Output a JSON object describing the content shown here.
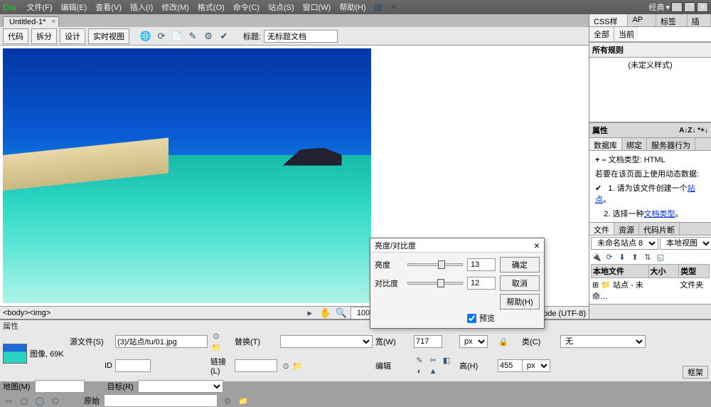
{
  "menubar": {
    "logo": "Dw",
    "items": [
      "文件(F)",
      "编辑(E)",
      "查看(V)",
      "插入(I)",
      "修改(M)",
      "格式(O)",
      "命令(C)",
      "站点(S)",
      "窗口(W)",
      "帮助(H)"
    ],
    "layout_label": "经典"
  },
  "doctab": {
    "name": "Untitled-1*"
  },
  "toolbar": {
    "view_buttons": [
      "代码",
      "拆分",
      "设计",
      "实时视图"
    ],
    "title_label": "标题:",
    "title_value": "无标题文档"
  },
  "dialog": {
    "title": "亮度/对比度",
    "brightness_label": "亮度",
    "brightness_value": "13",
    "contrast_label": "对比度",
    "contrast_value": "12",
    "ok": "确定",
    "cancel": "取消",
    "help": "帮助(H)",
    "preview": "预览"
  },
  "status": {
    "breadcrumb": "<body><img>",
    "zoom": "100%",
    "info": "1131 x 504 ▾  69 K / 2 秒 Unicode (UTF-8)"
  },
  "panel_css": {
    "tabs": [
      "CSS样式",
      "AP 元",
      "标签检",
      "插入"
    ],
    "sub_all": "全部",
    "sub_current": "当前",
    "rules_hdr": "所有规则",
    "rules_empty": "(未定义样式)"
  },
  "panel_attr": {
    "title": "属性",
    "az": "A↓Z↓ *+↓"
  },
  "panel_db": {
    "tabs": [
      "数据库",
      "绑定",
      "服务器行为"
    ],
    "doctype_label": "文档类型:",
    "doctype_value": "HTML",
    "hint": "若要在该页面上使用动态数据:",
    "step1_pre": "1. 请为该文件创建一个",
    "step1_link": "站点",
    "step2_pre": "2. 选择一种",
    "step2_link": "文档类型"
  },
  "panel_files": {
    "tabs": [
      "文件",
      "资源",
      "代码片断"
    ],
    "site": "未命名站点 8",
    "view": "本地视图",
    "cols": [
      "本地文件",
      "大小",
      "类型"
    ],
    "row_name": "站点 - 未命…",
    "row_type": "文件夹"
  },
  "frame_label": "框架",
  "props": {
    "hdr": "属性",
    "img_label": "图像, 69K",
    "src_label": "源文件(S)",
    "src_value": "(3)/站点/tu/01.jpg",
    "alt_label": "替换(T)",
    "w_label": "宽(W)",
    "w_value": "717",
    "px": "px",
    "class_label": "类(C)",
    "class_value": "无",
    "id_label": "ID",
    "link_label": "链接(L)",
    "edit_label": "编辑",
    "h_label": "高(H)",
    "h_value": "455",
    "map_label": "地图(M)",
    "target_label": "目标(R)",
    "orig_label": "原始"
  }
}
